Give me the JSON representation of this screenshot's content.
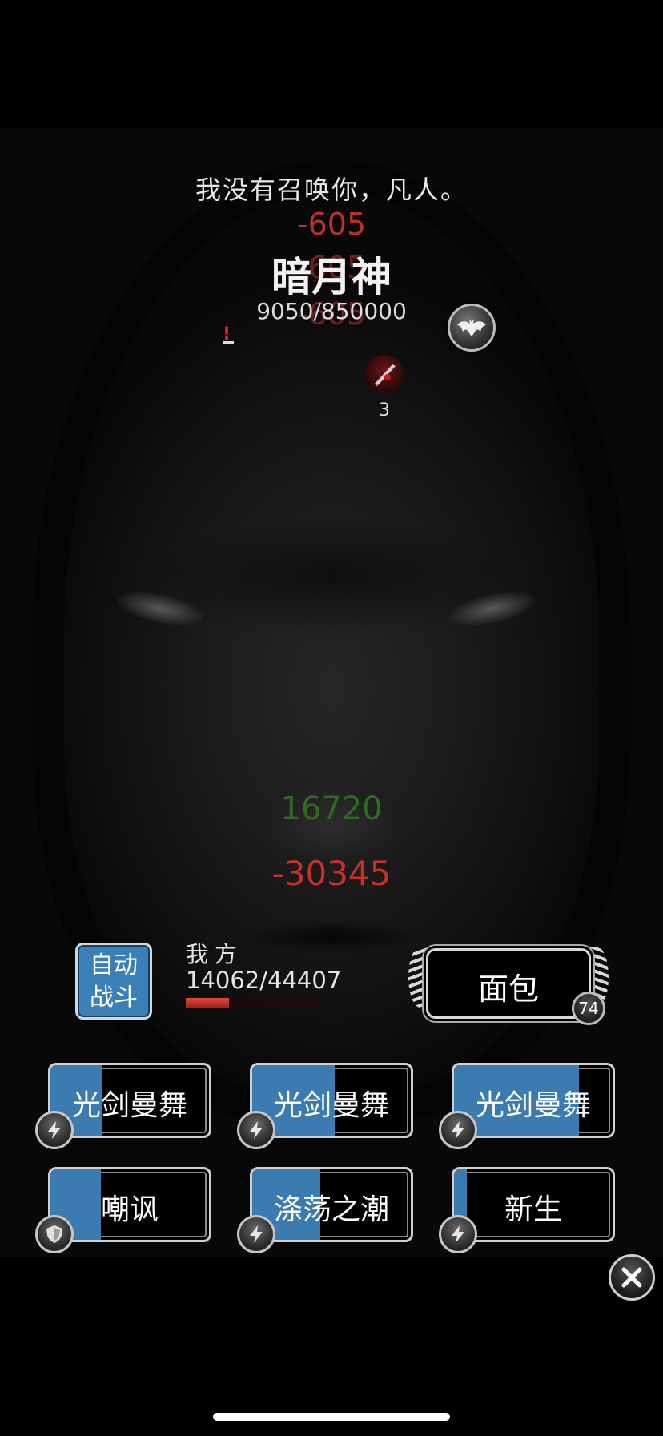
{
  "boss": {
    "dialog": "我没有召唤你，凡人。",
    "name": "暗月神",
    "hp": "9050/850000",
    "damage_popups": [
      "-605",
      "-605",
      "-605"
    ],
    "alert_mark": "!",
    "status_icon": "bat-icon",
    "effect": {
      "icon": "bleeding-blade-icon",
      "stacks": "3"
    }
  },
  "floating_numbers": {
    "heal": "16720",
    "damage": "-30345"
  },
  "auto_battle": {
    "label_line1": "自动",
    "label_line2": "战斗"
  },
  "team": {
    "label": "我方",
    "hp": "14062/44407",
    "hp_fraction": 0.3167,
    "bar_color": "#d63a2e"
  },
  "item": {
    "label": "面包",
    "count": "74"
  },
  "skills": [
    {
      "label": "光剑曼舞",
      "badge": "lightning-icon",
      "charge": 0.33
    },
    {
      "label": "光剑曼舞",
      "badge": "lightning-icon",
      "charge": 0.52
    },
    {
      "label": "光剑曼舞",
      "badge": "lightning-icon",
      "charge": 0.79
    },
    {
      "label": "嘲讽",
      "badge": "shield-icon",
      "charge": 0.32
    },
    {
      "label": "涤荡之潮",
      "badge": "lightning-icon",
      "charge": 0.43
    },
    {
      "label": "新生",
      "badge": "lightning-icon",
      "charge": 0.08
    }
  ],
  "colors": {
    "skill_fill": "#3b7bb0",
    "damage_red": "#c8302a",
    "heal_green": "#2e6a24"
  }
}
